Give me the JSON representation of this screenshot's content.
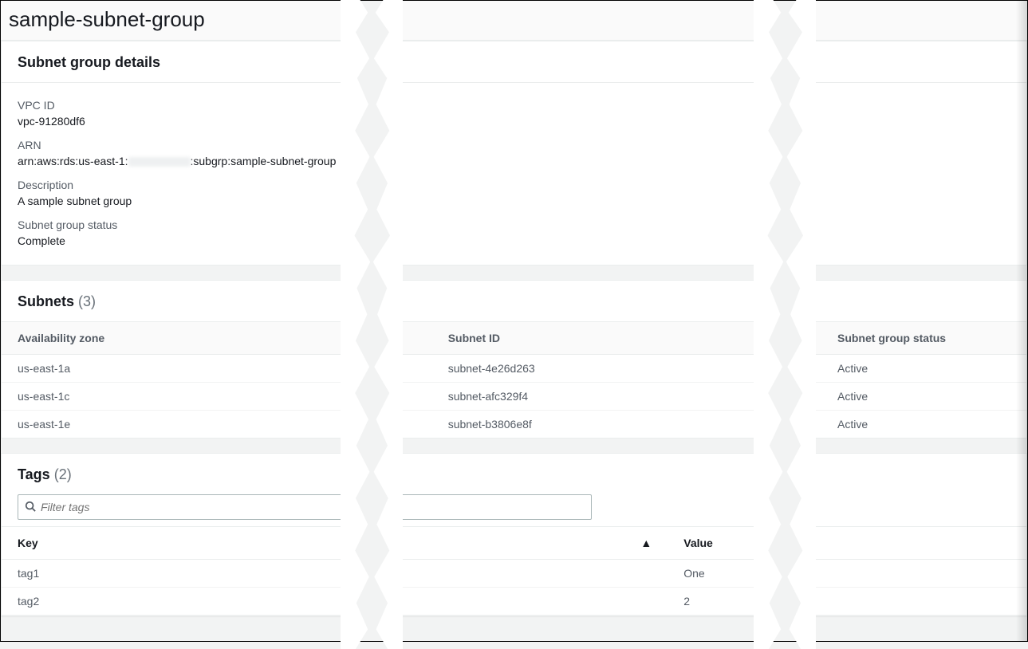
{
  "header": {
    "title": "sample-subnet-group"
  },
  "details": {
    "panel_title": "Subnet group details",
    "vpc_id_label": "VPC ID",
    "vpc_id_value": "vpc-91280df6",
    "arn_label": "ARN",
    "arn_prefix": "arn:aws:rds:us-east-1:",
    "arn_suffix": ":subgrp:sample-subnet-group",
    "description_label": "Description",
    "description_value": "A sample subnet group",
    "status_label": "Subnet group status",
    "status_value": "Complete"
  },
  "subnets": {
    "panel_title": "Subnets",
    "count": "(3)",
    "columns": {
      "az": "Availability zone",
      "subnet_id": "Subnet ID",
      "status": "Subnet group status"
    },
    "rows": [
      {
        "az": "us-east-1a",
        "subnet_id": "subnet-4e26d263",
        "status": "Active"
      },
      {
        "az": "us-east-1c",
        "subnet_id": "subnet-afc329f4",
        "status": "Active"
      },
      {
        "az": "us-east-1e",
        "subnet_id": "subnet-b3806e8f",
        "status": "Active"
      }
    ]
  },
  "tags": {
    "panel_title": "Tags",
    "count": "(2)",
    "filter_placeholder": "Filter tags",
    "columns": {
      "key": "Key",
      "value": "Value",
      "sort_indicator": "▲"
    },
    "rows": [
      {
        "key": "tag1",
        "value": "One"
      },
      {
        "key": "tag2",
        "value": "2"
      }
    ]
  }
}
